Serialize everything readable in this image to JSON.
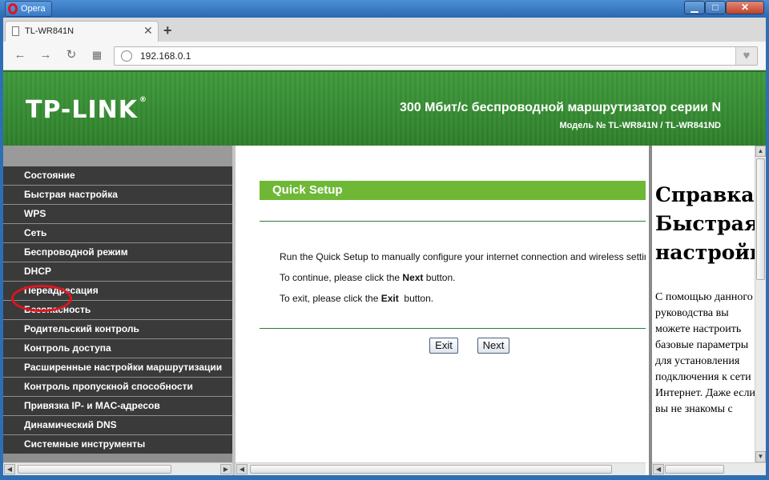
{
  "browser": {
    "app_name": "Opera",
    "tab_title": "TL-WR841N",
    "new_tab": "+",
    "url": "192.168.0.1"
  },
  "banner": {
    "logo": "TP-LINK",
    "logo_mark": "®",
    "title": "300 Мбит/с беспроводной маршрутизатор серии N",
    "model": "Модель № TL-WR841N / TL-WR841ND"
  },
  "menu": [
    {
      "label": "Состояние"
    },
    {
      "label": "Быстрая настройка"
    },
    {
      "label": "WPS"
    },
    {
      "label": "Сеть"
    },
    {
      "label": "Беспроводной режим"
    },
    {
      "label": "DHCP"
    },
    {
      "label": "Переадресация"
    },
    {
      "label": "Безопасность"
    },
    {
      "label": "Родительский контроль"
    },
    {
      "label": "Контроль доступа"
    },
    {
      "label": "Расширенные настройки маршрутизации"
    },
    {
      "label": "Контроль пропускной способности"
    },
    {
      "label": "Привязка IP- и MAC-адресов"
    },
    {
      "label": "Динамический DNS"
    },
    {
      "label": "Системные инструменты"
    }
  ],
  "main": {
    "heading": "Quick Setup",
    "line1": "Run the Quick Setup to manually configure your internet connection and wireless settings.",
    "line2_pre": "To continue, please click the ",
    "line2_bold": "Next",
    "line2_post": " button.",
    "line3_pre": "To exit, please click the ",
    "line3_bold": "Exit",
    "line3_post": "  button.",
    "exit_label": "Exit",
    "next_label": "Next"
  },
  "help": {
    "title_line1": "Справка",
    "title_line2": "Быстрая",
    "title_line3": "настройка",
    "text": "С помощью данного руководства вы можете настроить базовые параметры для установления подключения к сети Интернет. Даже если вы не знакомы с"
  },
  "annotation": {
    "color": "#e0141d",
    "highlighted_item": "Сеть"
  }
}
